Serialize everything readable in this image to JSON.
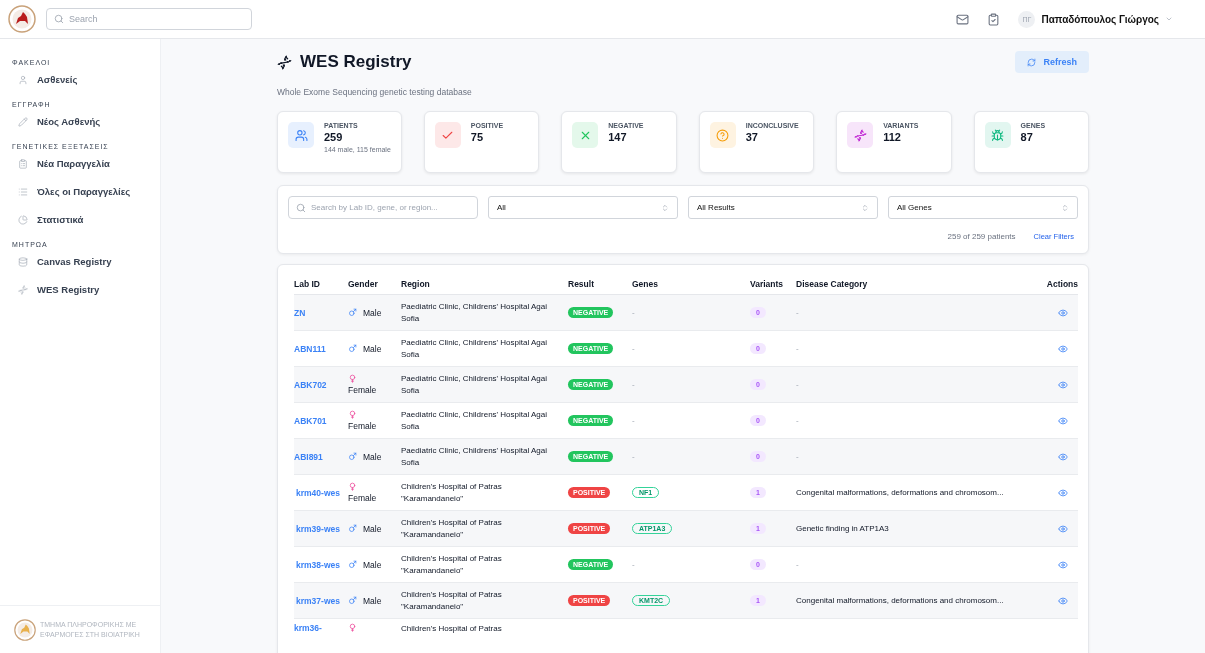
{
  "header": {
    "search": {
      "placeholder": "Search"
    },
    "user": {
      "initials": "ΠΓ",
      "name": "Παπαδόπουλος Γιώργος"
    }
  },
  "sidebar": {
    "sections": [
      {
        "title": "ΦΑΚΕΛΟΙ",
        "items": [
          {
            "kind": "user",
            "label": "Ασθενείς"
          }
        ]
      },
      {
        "title": "ΕΓΓΡΑΦΗ",
        "items": [
          {
            "kind": "pencil",
            "label": "Νέος Ασθενής"
          }
        ]
      },
      {
        "title": "ΓΕΝΕΤΙΚΕΣ ΕΞΕΤΑΣΕΙΣ",
        "items": [
          {
            "kind": "clipboard",
            "label": "Νέα Παραγγελία"
          },
          {
            "kind": "list",
            "label": "Όλες οι Παραγγελίες"
          },
          {
            "kind": "pie",
            "label": "Στατιστικά"
          }
        ]
      },
      {
        "title": "ΜΗΤΡΩΑ",
        "items": [
          {
            "kind": "database",
            "label": "Canvas Registry"
          },
          {
            "kind": "dna",
            "label": "WES Registry"
          }
        ]
      }
    ],
    "footer": {
      "line1": "ΤΜΗΜΑ ΠΛΗΡΟΦΟΡΙΚΗΣ ΜΕ",
      "line2": "ΕΦΑΡΜΟΓΕΣ ΣΤΗ ΒΙΟΙΑΤΡΙΚΗ"
    }
  },
  "page": {
    "title": "WES Registry",
    "subtitle": "Whole Exome Sequencing genetic testing database",
    "refresh": "Refresh"
  },
  "stats": [
    {
      "kind": "users",
      "color": "#3b82f6",
      "label": "PATIENTS",
      "value": "259",
      "note": "144 male, 115 female"
    },
    {
      "kind": "check",
      "color": "#ef4444",
      "label": "POSITIVE",
      "value": "75"
    },
    {
      "kind": "x",
      "color": "#22c55e",
      "label": "NEGATIVE",
      "value": "147"
    },
    {
      "kind": "question",
      "color": "#f59e0b",
      "label": "INCONCLUSIVE",
      "value": "37"
    },
    {
      "kind": "dna",
      "color": "#c026d3",
      "label": "VARIANTS",
      "value": "112"
    },
    {
      "kind": "virus",
      "color": "#10b981",
      "label": "GENES",
      "value": "87"
    }
  ],
  "filters": {
    "search": {
      "placeholder": "Search by Lab ID, gene, or region..."
    },
    "selects": [
      "All",
      "All Results",
      "All Genes"
    ],
    "count": "259 of 259 patients",
    "clear": "Clear Filters"
  },
  "table": {
    "columns": [
      "Lab ID",
      "Gender",
      "Region",
      "Result",
      "Genes",
      "Variants",
      "Disease Category",
      "Actions"
    ],
    "rows": [
      {
        "lab_id": "ZN",
        "gender": {
          "kind": "male",
          "label": "Male"
        },
        "region": "Paediatric Clinic, Childrens' Hospital Agai Sofia",
        "result": {
          "kind": "negative",
          "label": "NEGATIVE"
        },
        "genes": "-",
        "variants": "0",
        "disease": "-"
      },
      {
        "lab_id": "ABN111",
        "gender": {
          "kind": "male",
          "label": "Male"
        },
        "region": "Paediatric Clinic, Childrens' Hospital Agai Sofia",
        "result": {
          "kind": "negative",
          "label": "NEGATIVE"
        },
        "genes": "-",
        "variants": "0",
        "disease": "-"
      },
      {
        "lab_id": "ABK702",
        "gender": {
          "kind": "female",
          "label": "Female"
        },
        "region": "Paediatric Clinic, Childrens' Hospital Agai Sofia",
        "result": {
          "kind": "negative",
          "label": "NEGATIVE"
        },
        "genes": "-",
        "variants": "0",
        "disease": "-"
      },
      {
        "lab_id": "ABK701",
        "gender": {
          "kind": "female",
          "label": "Female"
        },
        "region": "Paediatric Clinic, Childrens' Hospital Agai Sofia",
        "result": {
          "kind": "negative",
          "label": "NEGATIVE"
        },
        "genes": "-",
        "variants": "0",
        "disease": "-"
      },
      {
        "lab_id": "ABI891",
        "gender": {
          "kind": "male",
          "label": "Male"
        },
        "region": "Paediatric Clinic, Childrens' Hospital Agai Sofia",
        "result": {
          "kind": "negative",
          "label": "NEGATIVE"
        },
        "genes": "-",
        "variants": "0",
        "disease": "-"
      },
      {
        "lab_id": "krm40-wes",
        "gender": {
          "kind": "female",
          "label": "Female"
        },
        "region": "Children's Hospital of Patras \"Karamandaneio\"",
        "result": {
          "kind": "positive",
          "label": "POSITIVE"
        },
        "gene_tags": [
          "NF1"
        ],
        "variants": "1",
        "disease": "Congenital malformations, deformations and chromosom..."
      },
      {
        "lab_id": "krm39-wes",
        "gender": {
          "kind": "male",
          "label": "Male"
        },
        "region": "Children's Hospital of Patras \"Karamandaneio\"",
        "result": {
          "kind": "positive",
          "label": "POSITIVE"
        },
        "gene_tags": [
          "ATP1A3"
        ],
        "variants": "1",
        "disease": "Genetic finding in ATP1A3"
      },
      {
        "lab_id": "krm38-wes",
        "gender": {
          "kind": "male",
          "label": "Male"
        },
        "region": "Children's Hospital of Patras \"Karamandaneio\"",
        "result": {
          "kind": "negative",
          "label": "NEGATIVE"
        },
        "genes": "-",
        "variants": "0",
        "disease": "-"
      },
      {
        "lab_id": "krm37-wes",
        "gender": {
          "kind": "male",
          "label": "Male"
        },
        "region": "Children's Hospital of Patras \"Karamandaneio\"",
        "result": {
          "kind": "positive",
          "label": "POSITIVE"
        },
        "gene_tags": [
          "KMT2C"
        ],
        "variants": "1",
        "disease": "Congenital malformations, deformations and chromosom..."
      },
      {
        "lab_id": "krm36-",
        "gender": {
          "kind": "female"
        },
        "region": "Children's Hospital of Patras"
      }
    ]
  }
}
